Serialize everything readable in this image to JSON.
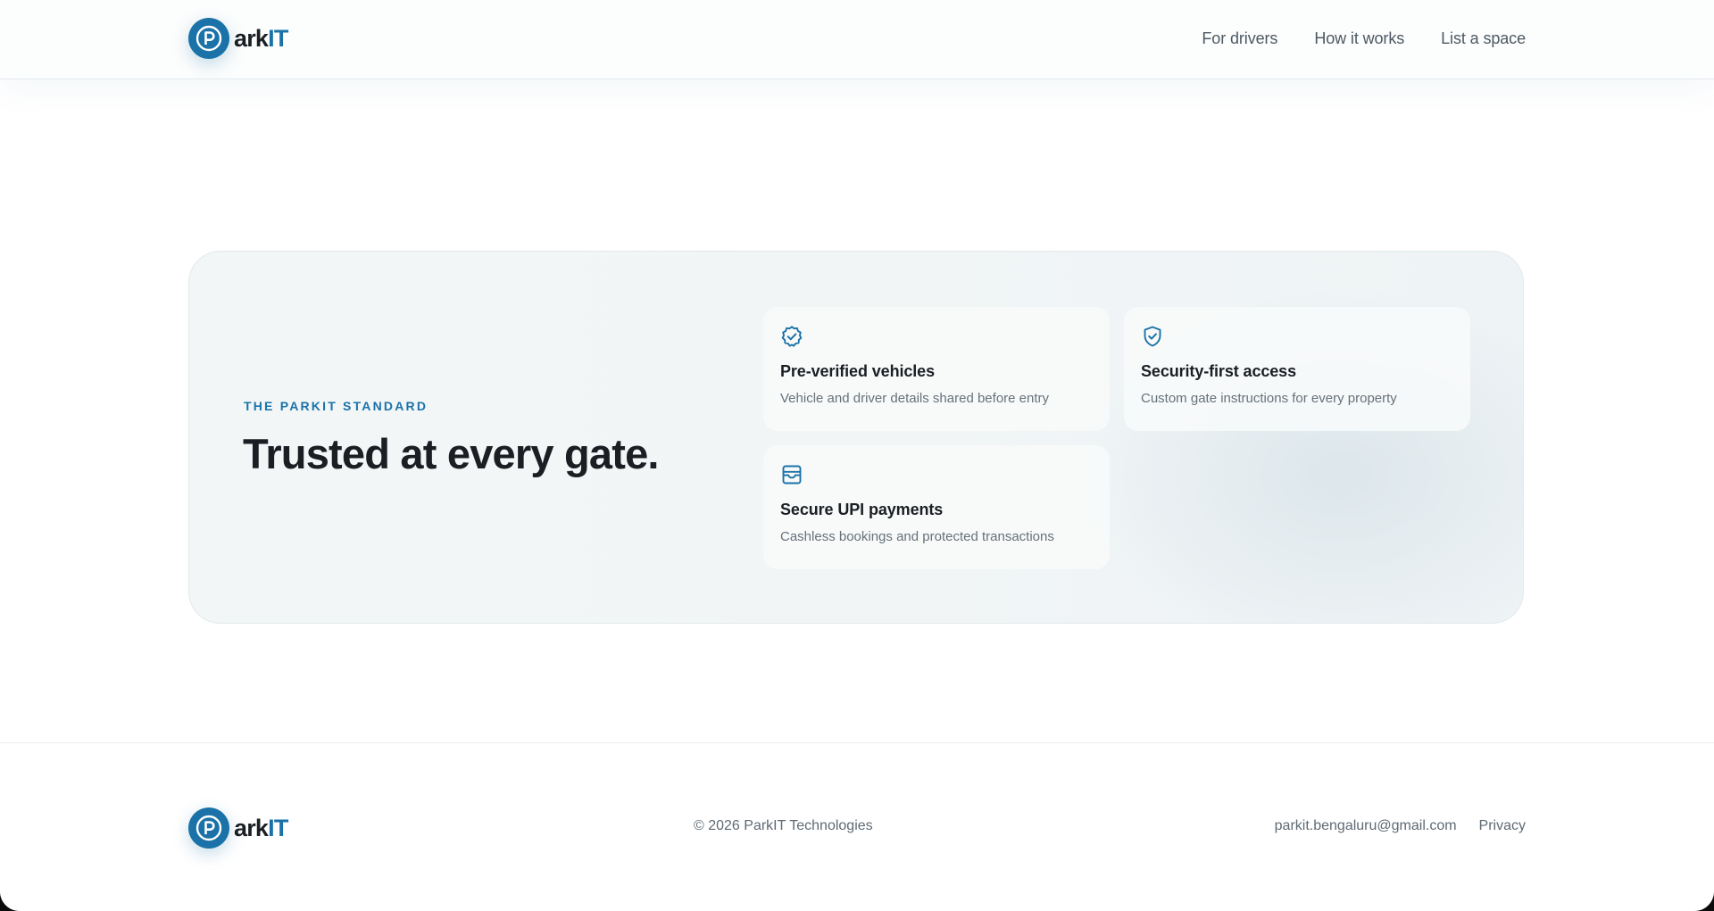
{
  "brand": {
    "name_prefix": "ark",
    "name_suffix": "IT",
    "primary_color": "#1a72a8",
    "logo_icon": "parking-p-icon"
  },
  "nav": {
    "items": [
      {
        "label": "For drivers"
      },
      {
        "label": "How it works"
      },
      {
        "label": "List a space"
      }
    ]
  },
  "standard": {
    "eyebrow": "THE PARKIT STANDARD",
    "headline": "Trusted at every gate.",
    "features": [
      {
        "icon": "verified-badge-icon",
        "title": "Pre-verified vehicles",
        "description": "Vehicle and driver details shared before entry"
      },
      {
        "icon": "shield-check-icon",
        "title": "Security-first access",
        "description": "Custom gate instructions for every property"
      },
      {
        "icon": "payment-card-icon",
        "title": "Secure UPI payments",
        "description": "Cashless bookings and protected transactions"
      }
    ]
  },
  "footer": {
    "copyright": "© 2026 ParkIT Technologies",
    "email": "parkit.bengaluru@gmail.com",
    "privacy": "Privacy"
  }
}
